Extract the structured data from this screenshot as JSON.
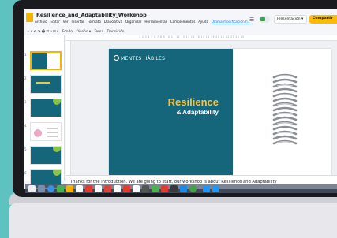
{
  "window": {
    "doc_title": "Resilience_and_Adaptability_Workshop",
    "title_icons": "☆ ⊡ ☁",
    "menu": [
      "Archivo",
      "Editar",
      "Ver",
      "Insertar",
      "Formato",
      "Diapositiva",
      "Organizar",
      "Herramientas",
      "Complementos",
      "Ayuda"
    ],
    "last_edit": "Última modificación h...",
    "present_label": "Presentación ▾",
    "share_label": "Compartir"
  },
  "toolbar": {
    "left_tools": "+ ▾  ↶ ↷  🖶  ⊡  ▾  ⊞  ▾",
    "fondo_label": "Fondo",
    "diseno_label": "Diseño ▾",
    "tema_label": "Tema",
    "transicion_label": "Transición"
  },
  "ruler": {
    "ticks": "1  2  3  4  5  6  7  8  9  10  11  12  13  14  15  16  17  18  19  20  21  22  23  24  25"
  },
  "filmstrip": {
    "slides": [
      "1",
      "2",
      "3",
      "4",
      "5",
      "6"
    ]
  },
  "slide": {
    "brand": "MENTES HÁBILES",
    "title": "Resilience",
    "subtitle": "& Adaptability"
  },
  "notes": {
    "text": "Thanks for the introduction. We are going to start, our workshop is about Resilience and Adaptability"
  },
  "colors": {
    "teal": "#15667a",
    "title_yellow": "#f5c242",
    "share_yellow": "#fbbc04"
  }
}
